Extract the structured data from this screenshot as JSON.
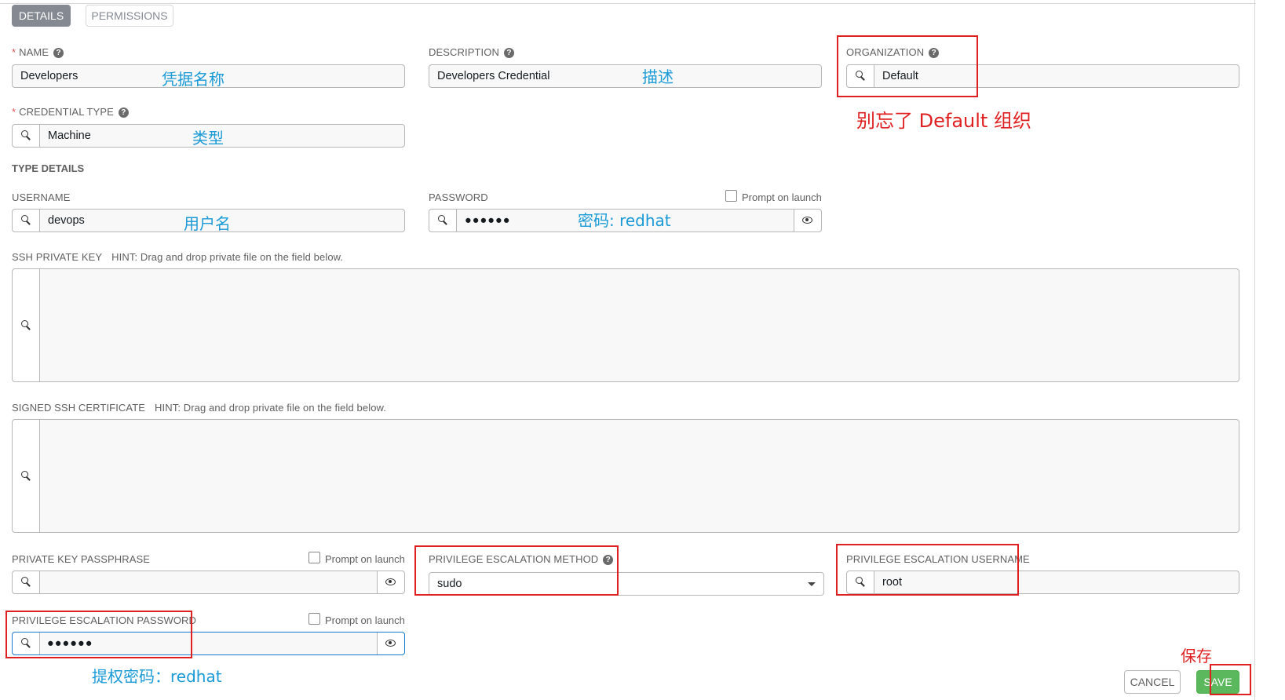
{
  "tabs": {
    "details": "DETAILS",
    "permissions": "PERMISSIONS"
  },
  "fields": {
    "name": {
      "required_mark": "*",
      "label": "NAME",
      "value": "Developers"
    },
    "description": {
      "label": "DESCRIPTION",
      "value": "Developers Credential"
    },
    "organization": {
      "label": "ORGANIZATION",
      "value": "Default"
    },
    "credential_type": {
      "required_mark": "*",
      "label": "CREDENTIAL TYPE",
      "value": "Machine"
    },
    "type_details_title": "TYPE DETAILS",
    "username": {
      "label": "USERNAME",
      "value": "devops"
    },
    "password": {
      "label": "PASSWORD",
      "value": "●●●●●●",
      "prompt": "Prompt on launch"
    },
    "ssh_private_key": {
      "label": "SSH PRIVATE KEY",
      "hint": "HINT: Drag and drop private file on the field below."
    },
    "signed_ssh_certificate": {
      "label": "SIGNED SSH CERTIFICATE",
      "hint": "HINT: Drag and drop private file on the field below."
    },
    "private_key_passphrase": {
      "label": "PRIVATE KEY PASSPHRASE",
      "value": "",
      "prompt": "Prompt on launch"
    },
    "privilege_escalation_method": {
      "label": "PRIVILEGE ESCALATION METHOD",
      "value": "sudo"
    },
    "privilege_escalation_username": {
      "label": "PRIVILEGE ESCALATION USERNAME",
      "value": "root"
    },
    "privilege_escalation_password": {
      "label": "PRIVILEGE ESCALATION PASSWORD",
      "value": "●●●●●●",
      "prompt": "Prompt on launch"
    }
  },
  "help_glyph": "?",
  "buttons": {
    "cancel": "CANCEL",
    "save": "SAVE"
  },
  "annotations": {
    "name": "凭据名称",
    "description": "描述",
    "organization": "别忘了 Default 组织",
    "type": "类型",
    "username": "用户名",
    "password": "密码: redhat",
    "become_password": "提权密码：redhat",
    "save": "保存"
  },
  "icons": [
    "search-icon",
    "eye-icon",
    "help-icon",
    "chevron-down-icon",
    "checkbox"
  ],
  "colors": {
    "save": "#5cb85c",
    "active_tab": "#848992",
    "annotation_blue": "#1a9ad6",
    "annotation_red": "#e02020",
    "focus_border": "#1a7bd1"
  }
}
